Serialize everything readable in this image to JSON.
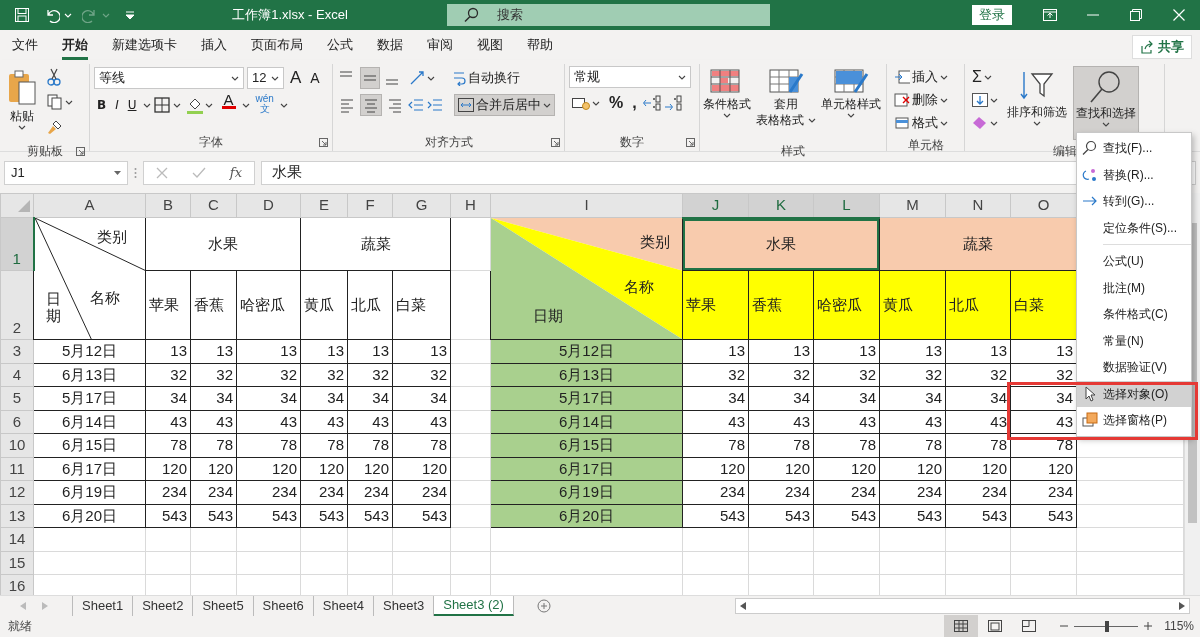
{
  "title_bar": {
    "title": "工作簿1.xlsx  -  Excel",
    "redo_disabled": true,
    "search_placeholder": "搜索",
    "sign_in": "登录"
  },
  "menu_tabs": [
    {
      "label": "文件",
      "selected": false
    },
    {
      "label": "开始",
      "selected": true
    },
    {
      "label": "新建选项卡",
      "selected": false
    },
    {
      "label": "插入",
      "selected": false
    },
    {
      "label": "页面布局",
      "selected": false
    },
    {
      "label": "公式",
      "selected": false
    },
    {
      "label": "数据",
      "selected": false
    },
    {
      "label": "审阅",
      "selected": false
    },
    {
      "label": "视图",
      "selected": false
    },
    {
      "label": "帮助",
      "selected": false
    }
  ],
  "share": "共享",
  "ribbon": {
    "clipboard": {
      "label": "剪贴板",
      "paste": "粘贴"
    },
    "font": {
      "label": "字体",
      "font_name": "等线",
      "font_size": "12",
      "grow": "A",
      "shrink": "A",
      "styles": [
        "B",
        "I",
        "U"
      ],
      "font_color": "A",
      "phonetic_top": "wén",
      "phonetic_bottom": "文"
    },
    "alignment": {
      "label": "对齐方式",
      "vertical": [
        {
          "selected": false
        },
        {
          "selected": true
        },
        {
          "selected": false
        }
      ],
      "horizontal": [
        {
          "selected": false
        },
        {
          "selected": true
        },
        {
          "selected": false
        }
      ],
      "wrap": "自动换行",
      "merge": {
        "label": "合并后居中",
        "selected": true
      }
    },
    "number": {
      "label": "数字",
      "format": "常规",
      "symbols": [
        "%",
        ","
      ]
    },
    "styles": {
      "label": "样式",
      "buttons": [
        [
          "条件格式"
        ],
        [
          "套用",
          "表格格式"
        ],
        [
          "单元格样式"
        ]
      ]
    },
    "cells": {
      "label": "单元格",
      "buttons": [
        "插入",
        "删除",
        "格式"
      ]
    },
    "editing": {
      "label": "编辑",
      "sum": "Σ",
      "sort": "排序和筛选",
      "find": {
        "label": "查找和选择",
        "selected": true
      }
    }
  },
  "formula_bar": {
    "name_box": "J1",
    "function_label": "fx",
    "formula": "水果"
  },
  "sheet": {
    "columns": [
      {
        "label": "A",
        "selected": false
      },
      {
        "label": "B",
        "selected": false
      },
      {
        "label": "C",
        "selected": false
      },
      {
        "label": "D",
        "selected": false
      },
      {
        "label": "E",
        "selected": false
      },
      {
        "label": "F",
        "selected": false
      },
      {
        "label": "G",
        "selected": false
      },
      {
        "label": "H",
        "selected": false
      },
      {
        "label": "I",
        "selected": false
      },
      {
        "label": "J",
        "selected": true
      },
      {
        "label": "K",
        "selected": true
      },
      {
        "label": "L",
        "selected": true
      },
      {
        "label": "M",
        "selected": false
      },
      {
        "label": "N",
        "selected": false
      },
      {
        "label": "O",
        "selected": false
      }
    ],
    "row_headers": [
      {
        "label": "1",
        "selected": true
      },
      {
        "label": "2",
        "selected": false
      },
      {
        "label": "3",
        "selected": false
      },
      {
        "label": "4",
        "selected": false
      },
      {
        "label": "5",
        "selected": false
      },
      {
        "label": "6",
        "selected": false
      },
      {
        "label": "10",
        "selected": false
      },
      {
        "label": "11",
        "selected": false
      },
      {
        "label": "12",
        "selected": false
      },
      {
        "label": "13",
        "selected": false
      },
      {
        "label": "14",
        "selected": false
      },
      {
        "label": "15",
        "selected": false
      },
      {
        "label": "16",
        "selected": false
      }
    ],
    "tables": [
      {
        "kind": "lined",
        "corner": {
          "top": "类别",
          "middle": "名称",
          "bottom": "日期"
        },
        "groups": [
          {
            "label": "水果",
            "selected": false,
            "items": [
              "苹果",
              "香蕉",
              "哈密瓜"
            ]
          },
          {
            "label": "蔬菜",
            "selected": false,
            "items": [
              "黄瓜",
              "北瓜",
              "白菜"
            ]
          }
        ],
        "rows": [
          {
            "date": "5月12日",
            "values": [
              "13",
              "13",
              "13",
              "13",
              "13",
              "13"
            ]
          },
          {
            "date": "6月13日",
            "values": [
              "32",
              "32",
              "32",
              "32",
              "32",
              "32"
            ]
          },
          {
            "date": "5月17日",
            "values": [
              "34",
              "34",
              "34",
              "34",
              "34",
              "34"
            ]
          },
          {
            "date": "6月14日",
            "values": [
              "43",
              "43",
              "43",
              "43",
              "43",
              "43"
            ]
          },
          {
            "date": "6月15日",
            "values": [
              "78",
              "78",
              "78",
              "78",
              "78",
              "78"
            ]
          },
          {
            "date": "6月17日",
            "values": [
              "120",
              "120",
              "120",
              "120",
              "120",
              "120"
            ]
          },
          {
            "date": "6月19日",
            "values": [
              "234",
              "234",
              "234",
              "234",
              "234",
              "234"
            ]
          },
          {
            "date": "6月20日",
            "values": [
              "543",
              "543",
              "543",
              "543",
              "543",
              "543"
            ]
          }
        ]
      },
      {
        "kind": "colored",
        "corner": {
          "top": "类别",
          "middle": "名称",
          "bottom": "日期"
        },
        "groups": [
          {
            "label": "水果",
            "selected": true,
            "items": [
              "苹果",
              "香蕉",
              "哈密瓜"
            ]
          },
          {
            "label": "蔬菜",
            "selected": false,
            "items": [
              "黄瓜",
              "北瓜",
              "白菜"
            ]
          }
        ],
        "rows": [
          {
            "date": "5月12日",
            "values": [
              "13",
              "13",
              "13",
              "13",
              "13",
              "13"
            ]
          },
          {
            "date": "6月13日",
            "values": [
              "32",
              "32",
              "32",
              "32",
              "32",
              "32"
            ]
          },
          {
            "date": "5月17日",
            "values": [
              "34",
              "34",
              "34",
              "34",
              "34",
              "34"
            ]
          },
          {
            "date": "6月14日",
            "values": [
              "43",
              "43",
              "43",
              "43",
              "43",
              "43"
            ]
          },
          {
            "date": "6月15日",
            "values": [
              "78",
              "78",
              "78",
              "78",
              "78",
              "78"
            ]
          },
          {
            "date": "6月17日",
            "values": [
              "120",
              "120",
              "120",
              "120",
              "120",
              "120"
            ]
          },
          {
            "date": "6月19日",
            "values": [
              "234",
              "234",
              "234",
              "234",
              "234",
              "234"
            ]
          },
          {
            "date": "6月20日",
            "values": [
              "543",
              "543",
              "543",
              "543",
              "543",
              "543"
            ]
          }
        ]
      }
    ]
  },
  "dropdown_menu": {
    "sections": [
      [
        {
          "label": "查找(F)...",
          "selected": false
        },
        {
          "label": "替换(R)...",
          "selected": false
        },
        {
          "label": "转到(G)...",
          "selected": false
        },
        {
          "label": "定位条件(S)...",
          "selected": false
        }
      ],
      [
        {
          "label": "公式(U)",
          "selected": false
        },
        {
          "label": "批注(M)",
          "selected": false
        },
        {
          "label": "条件格式(C)",
          "selected": false
        },
        {
          "label": "常量(N)",
          "selected": false
        },
        {
          "label": "数据验证(V)",
          "selected": false
        },
        {
          "label": "选择对象(O)",
          "selected": true
        },
        {
          "label": "选择窗格(P)",
          "selected": false
        }
      ]
    ]
  },
  "annotations": [
    {
      "kind": "box"
    }
  ],
  "sheet_tabs": [
    {
      "label": "Sheet1",
      "selected": false
    },
    {
      "label": "Sheet2",
      "selected": false
    },
    {
      "label": "Sheet5",
      "selected": false
    },
    {
      "label": "Sheet6",
      "selected": false
    },
    {
      "label": "Sheet4",
      "selected": false
    },
    {
      "label": "Sheet3",
      "selected": false
    },
    {
      "label": "Sheet3 (2)",
      "selected": true
    }
  ],
  "status_bar": {
    "status": "就绪",
    "views": [
      {
        "selected": true
      },
      {
        "selected": false
      },
      {
        "selected": false
      }
    ],
    "zoom": {
      "level": 0.52,
      "reading": "115%"
    }
  }
}
